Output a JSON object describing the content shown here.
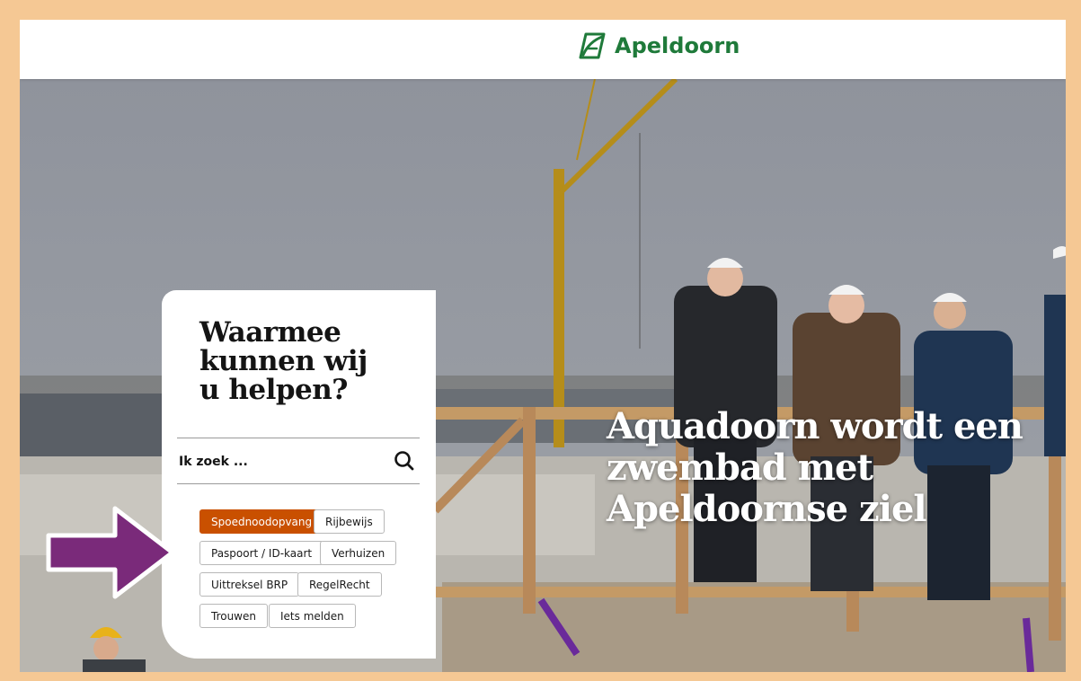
{
  "header": {
    "brand": "Apeldoorn",
    "logo_icon": "leaf-book-icon"
  },
  "hero": {
    "headline_lines": [
      "Aquadoorn wordt een",
      "zwembad met",
      "Apeldoornse ziel"
    ]
  },
  "help": {
    "title_lines": [
      "Waarmee",
      "kunnen wij",
      "u helpen?"
    ],
    "search_placeholder": "Ik zoek ...",
    "search_icon": "search-icon",
    "chips": [
      "Spoednoodopvang",
      "Rijbewijs",
      "Paspoort / ID-kaart",
      "Verhuizen",
      "Uittreksel BRP",
      "RegelRecht",
      "Trouwen",
      "Iets melden"
    ]
  },
  "colors": {
    "frame": "#f5c894",
    "brand_green": "#1f7a3a",
    "chip_active": "#c95000",
    "arrow": "#7a2a7a"
  }
}
